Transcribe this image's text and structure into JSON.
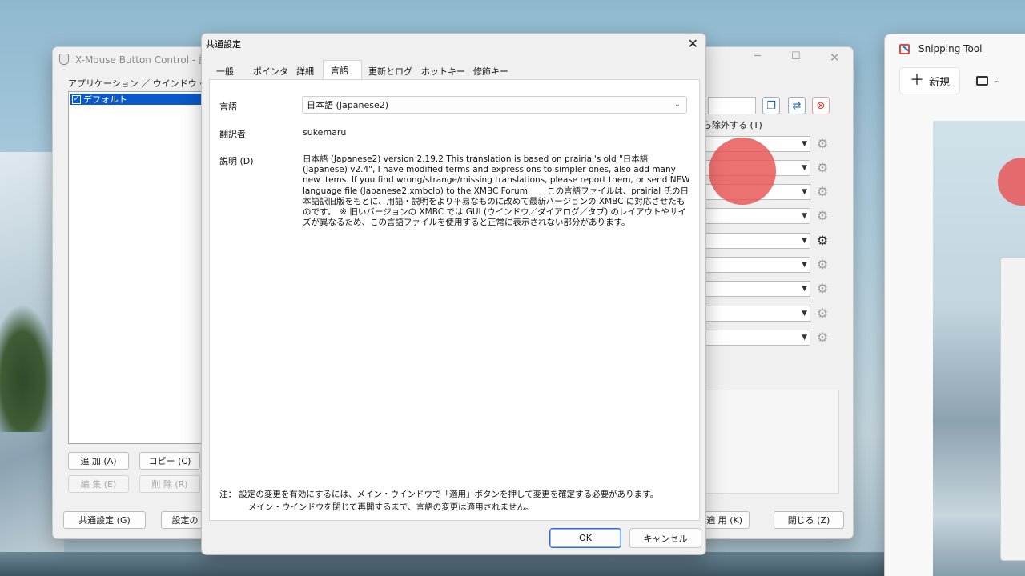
{
  "back_window": {
    "title": "X-Mouse Button Control - 設",
    "app_list_label": "アプリケーション ／ ウインドウ・クラス",
    "app_list_items": [
      {
        "label": "デフォルト",
        "checked": true
      }
    ],
    "buttons": {
      "add": "追 加 (A)",
      "copy": "コピー (C)",
      "edit": "編 集 (E)",
      "delete": "削 除 (R)",
      "common_settings": "共通設定 (G)",
      "settings_partial": "設定の",
      "apply": "適 用 (K)",
      "close": "閉じる (Z)"
    },
    "exclude_label": "ら除外する (T)"
  },
  "dialog": {
    "title": "共通設定",
    "tabs": [
      {
        "label": "一般",
        "active": false
      },
      {
        "label": "ポインタ",
        "active": false
      },
      {
        "label": "詳細",
        "active": false
      },
      {
        "label": "言語",
        "active": true
      },
      {
        "label": "更新とログ",
        "active": false
      },
      {
        "label": "ホットキー",
        "active": false
      },
      {
        "label": "修飾キー",
        "active": false
      }
    ],
    "language_label": "言語",
    "language_value": "日本語 (Japanese2)",
    "translator_label": "翻訳者",
    "translator_value": "sukemaru",
    "description_label": "説明 (D)",
    "description_text": "日本語 (Japanese2) version 2.19.2  This translation is based on prairial's old \"日本語 (Japanese) v2.4\",  I have modified terms and expressions to simpler ones,  also add many new items.  If you find wrong/strange/missing translations,  please report them,  or send NEW language file (Japanese2.xmbclp) to the XMBC Forum.　　この言語ファイルは、prairial 氏の日本語訳旧版をもとに、用語・説明をより平易なものに改めて最新バージョンの XMBC に対応させたものです。　※ 旧いバージョンの XMBC では GUI (ウインドウ／ダイアログ／タブ) のレイアウトやサイズが異なるため、この言語ファイルを使用すると正常に表示されない部分があります。",
    "note_line1": "注：  設定の変更を有効にするには、メイン・ウインドウで「適用」ボタンを押して変更を確定する必要があります。",
    "note_line2": "メイン・ウインドウを閉じて再開するまで、言語の変更は適用されません。",
    "ok_label": "OK",
    "cancel_label": "キャンセル"
  },
  "snipping_tool": {
    "title": "Snipping Tool",
    "new_label": "新規"
  },
  "colors": {
    "selection": "#0a58ca",
    "cursor_indicator": "#e85252",
    "primary_button_border": "#2e6fd6"
  }
}
